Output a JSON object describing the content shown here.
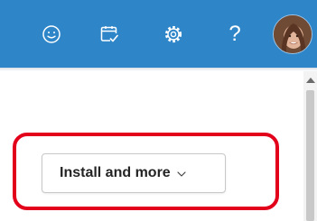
{
  "header": {
    "background_color": "#2e86c8",
    "icons": [
      {
        "name": "feedback-smile-icon",
        "label": ""
      },
      {
        "name": "calendar-check-icon",
        "label": ""
      },
      {
        "name": "gear-icon",
        "label": ""
      },
      {
        "name": "help-icon",
        "label": "?"
      },
      {
        "name": "avatar",
        "label": ""
      }
    ]
  },
  "main": {
    "install_button": {
      "label": "Install and more",
      "icon": "chevron-down-icon"
    },
    "highlight_color": "#e3001b"
  }
}
